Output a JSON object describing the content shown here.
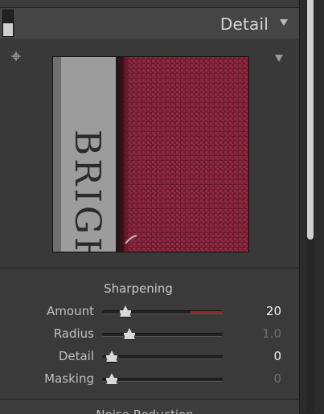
{
  "panel": {
    "title": "Detail",
    "collapse_icon": "triangle-down-icon",
    "solo_icon": "panel-switch-icon"
  },
  "zoom": {
    "target_icon": "target-crosshair-icon",
    "menu_icon": "triangle-down-icon",
    "preview_text": "BRIGH",
    "colors": {
      "fabric": "#7a1f35",
      "paper": "#9c9c9c",
      "ink": "#2a2a2a"
    }
  },
  "sharpening": {
    "title": "Sharpening",
    "sliders": [
      {
        "label": "Amount",
        "value": "20",
        "fraction": 0.133,
        "active": true
      },
      {
        "label": "Radius",
        "value": "1.0",
        "fraction": 0.175,
        "active": false
      },
      {
        "label": "Detail",
        "value": "0",
        "fraction": 0.0,
        "active": true
      },
      {
        "label": "Masking",
        "value": "0",
        "fraction": 0.0,
        "active": false
      }
    ],
    "accent": "#8a2a2a"
  },
  "next_section": {
    "title": "Noise Reduction"
  }
}
